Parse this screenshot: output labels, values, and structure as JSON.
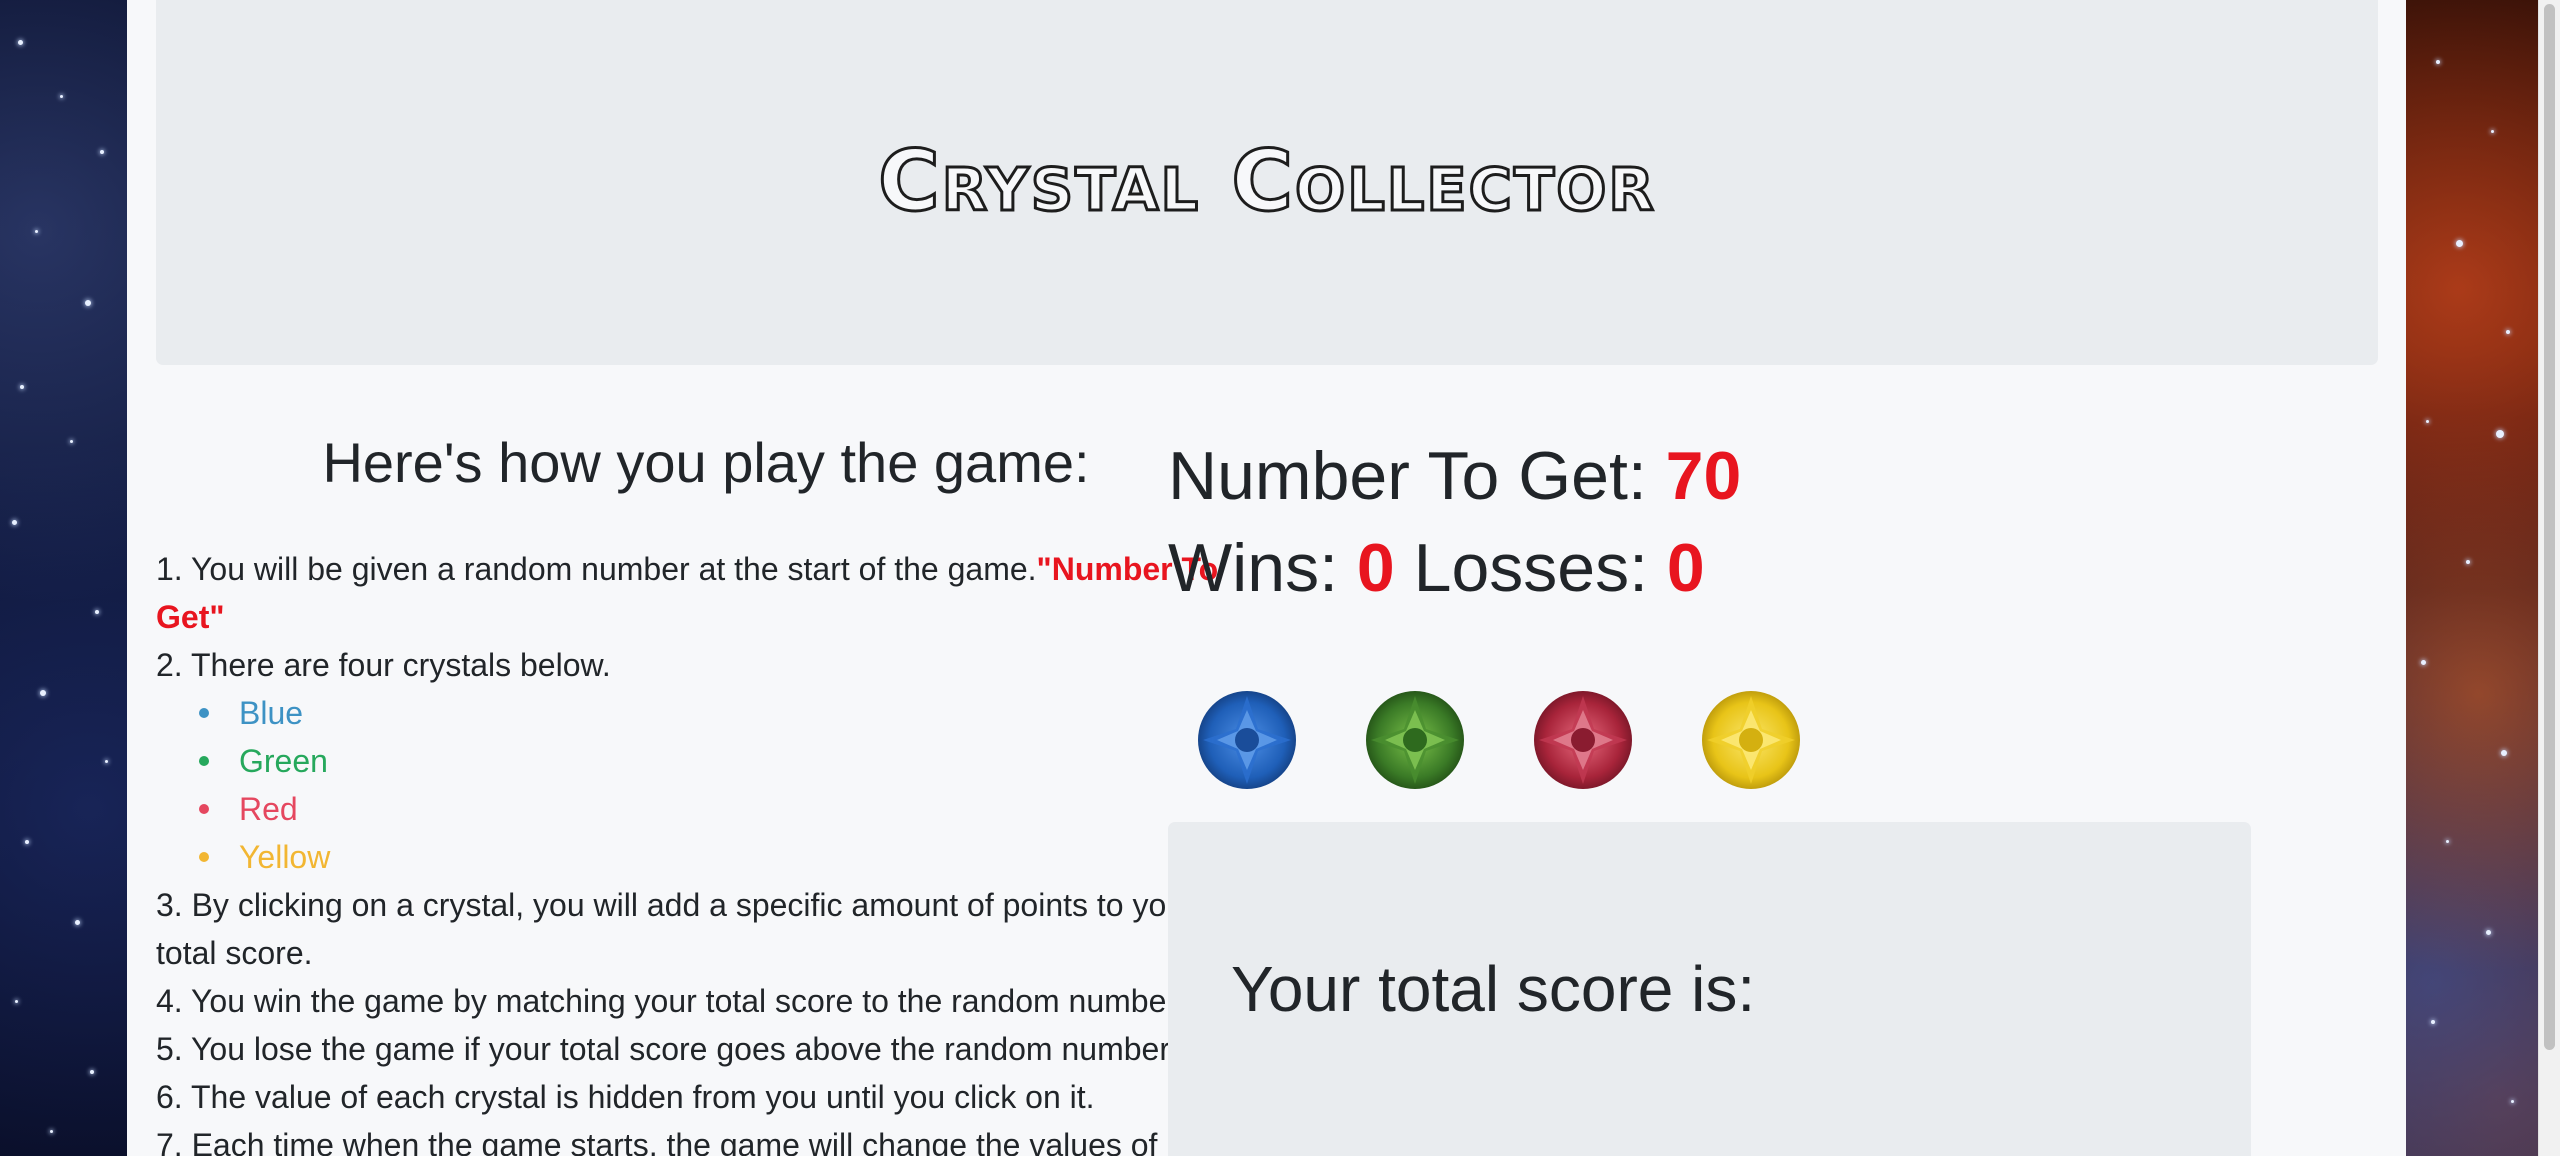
{
  "header": {
    "title": "Crystal Collector"
  },
  "instructions": {
    "heading": "Here's how you play the game:",
    "step1_text": "1. You will be given a random number at the start of the game.",
    "step1_highlight": "\"Number To Get\"",
    "step2_text": "2. There are four crystals below.",
    "crystal_list": [
      "Blue",
      "Green",
      "Red",
      "Yellow"
    ],
    "step3_text": "3. By clicking on a crystal, you will add a specific amount of points to your total score.",
    "step4_text": "4. You win the game by matching your total score to the random number.",
    "step5_text": "5. You lose the game if your total score goes above the random number.",
    "step6_text": "6. The value of each crystal is hidden from you until you click on it.",
    "step7_text": "7. Each time when the game starts, the game will change the values of"
  },
  "stats": {
    "number_label": "Number To Get:",
    "number_value": "70",
    "wins_label": "Wins:",
    "wins_value": "0",
    "losses_label": "Losses:",
    "losses_value": "0"
  },
  "crystals": [
    {
      "name": "blue",
      "color": "#1f5fb8"
    },
    {
      "name": "green",
      "color": "#3a7a26"
    },
    {
      "name": "red",
      "color": "#a8243a"
    },
    {
      "name": "yellow",
      "color": "#e8c418"
    }
  ],
  "score": {
    "label": "Your total score is:"
  },
  "colors": {
    "accent": "#e8151f",
    "list_blue": "#3d92c4",
    "list_green": "#26a85c",
    "list_red": "#e5475f",
    "list_yellow": "#f2b632"
  }
}
